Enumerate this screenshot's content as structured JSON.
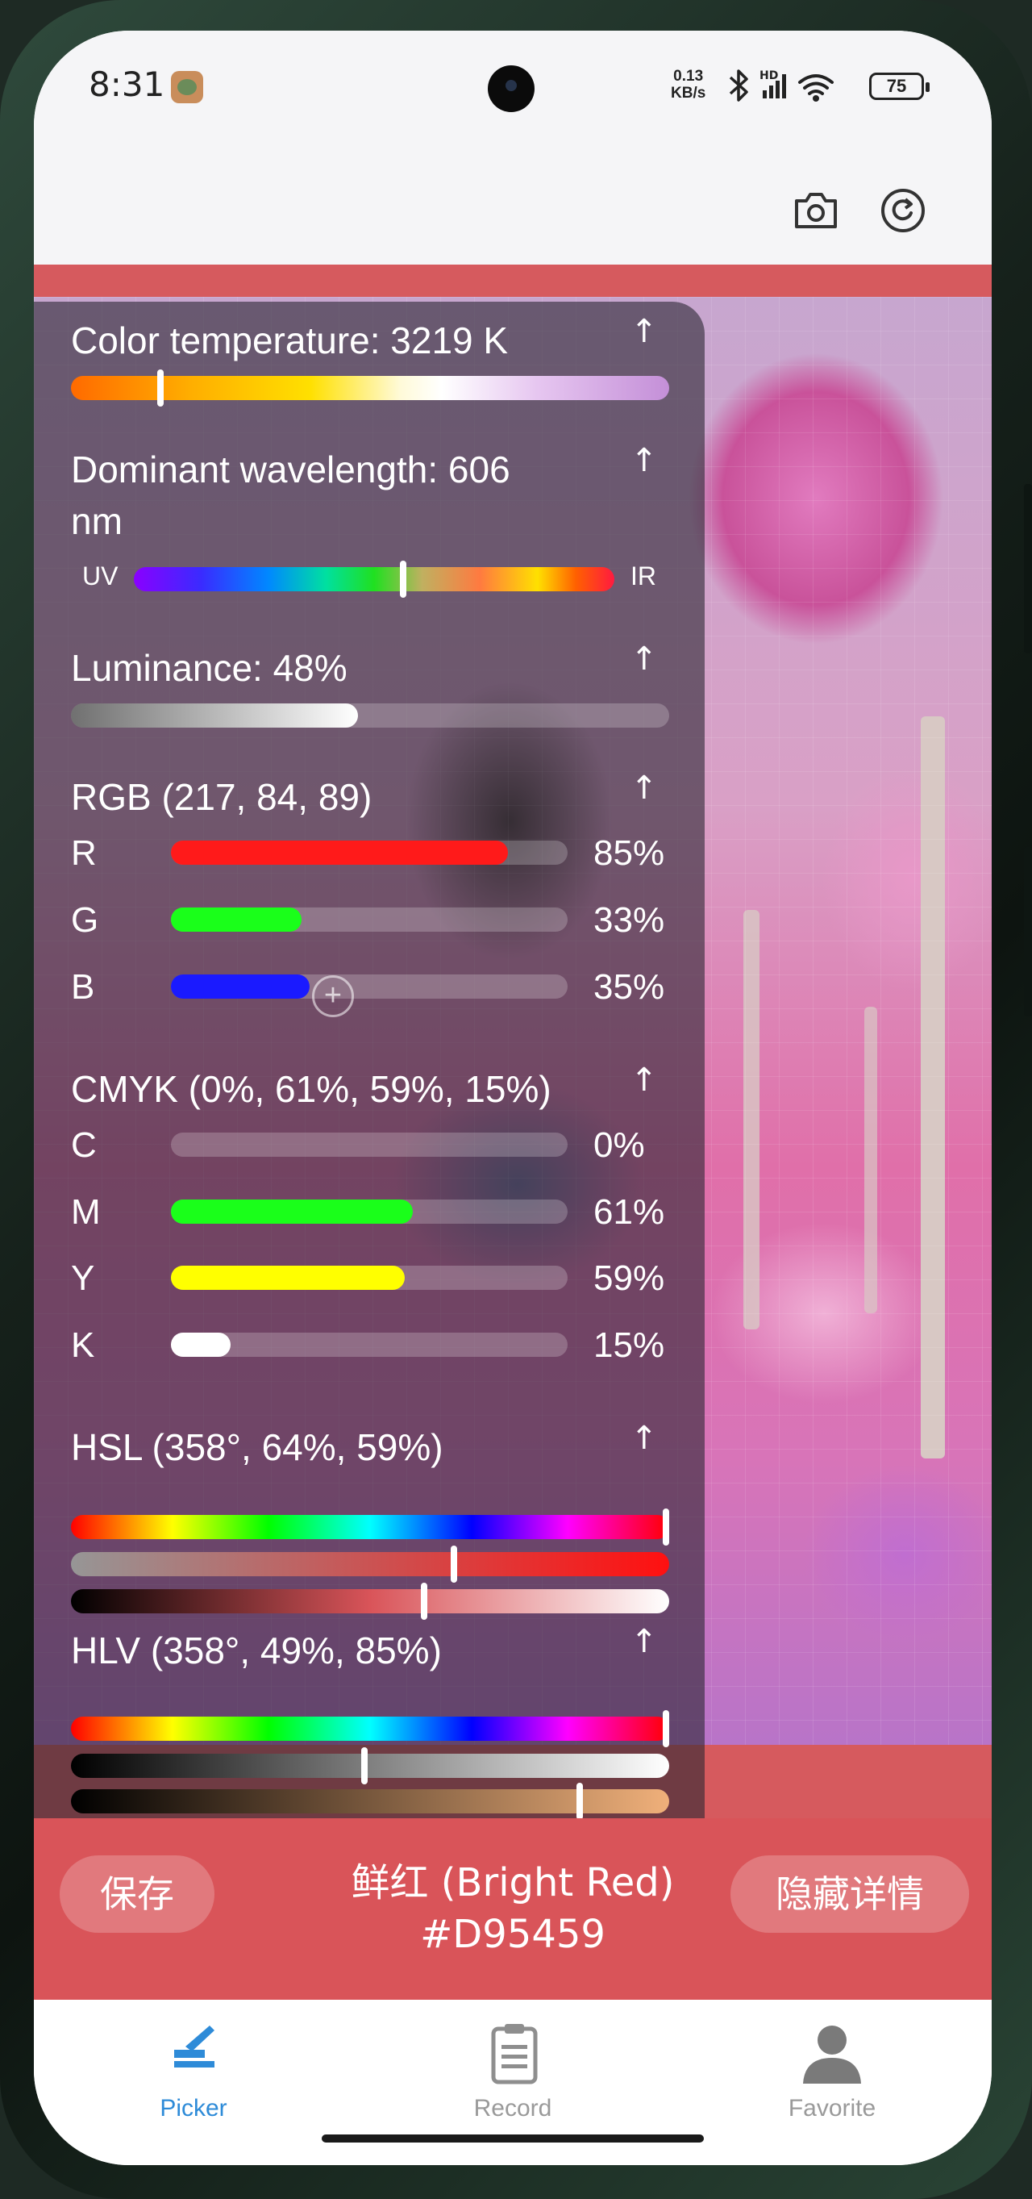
{
  "status_bar": {
    "time": "8:31",
    "net_speed_value": "0.13",
    "net_speed_unit": "KB/s",
    "network_badge": "HD",
    "battery": "75"
  },
  "toolbar": {
    "camera_icon": "camera-icon",
    "refresh_icon": "refresh-icon"
  },
  "details": {
    "color_temperature": {
      "title": "Color temperature: 3219 K",
      "level": 0.15
    },
    "dominant_wavelength": {
      "title_line1": "Dominant wavelength: 606",
      "title_line2": "nm",
      "uv_label": "UV",
      "ir_label": "IR",
      "level": 0.56
    },
    "luminance": {
      "title": "Luminance: 48%",
      "level": 0.48
    },
    "rgb": {
      "title": "RGB (217, 84, 89)",
      "channels": [
        {
          "label": "R",
          "value": "85%",
          "level": 0.85,
          "color": "#ff1a1a"
        },
        {
          "label": "G",
          "value": "33%",
          "level": 0.33,
          "color": "#1aff1a"
        },
        {
          "label": "B",
          "value": "35%",
          "level": 0.35,
          "color": "#1a1aff"
        }
      ]
    },
    "cmyk": {
      "title": "CMYK (0%, 61%, 59%, 15%)",
      "channels": [
        {
          "label": "C",
          "value": "0%",
          "level": 0.0,
          "color": "#00ffff"
        },
        {
          "label": "M",
          "value": "61%",
          "level": 0.61,
          "color": "#1aff1a"
        },
        {
          "label": "Y",
          "value": "59%",
          "level": 0.59,
          "color": "#ffff00"
        },
        {
          "label": "K",
          "value": "15%",
          "level": 0.15,
          "color": "#ffffff"
        }
      ]
    },
    "hsl": {
      "title": "HSL (358°, 64%, 59%)",
      "hue_level": 0.994,
      "saturation_level": 0.64,
      "lightness_level": 0.59
    },
    "hlv": {
      "title": "HLV (358°, 49%, 85%)",
      "hue_level": 0.994,
      "l_level": 0.49,
      "v_level": 0.85
    },
    "arrow_glyph": "↑"
  },
  "color_bar": {
    "save_label": "保存",
    "color_name": "鲜红 (Bright Red)",
    "hex": "#D95459",
    "hide_details_label": "隐藏详情",
    "color": "#D95459"
  },
  "nav": {
    "items": [
      {
        "label": "Picker",
        "icon": "picker-icon",
        "active": true
      },
      {
        "label": "Record",
        "icon": "record-icon",
        "active": false
      },
      {
        "label": "Favorite",
        "icon": "favorite-icon",
        "active": false
      }
    ],
    "active_color": "#2e8bd8",
    "inactive_color": "#9a9a9a"
  }
}
